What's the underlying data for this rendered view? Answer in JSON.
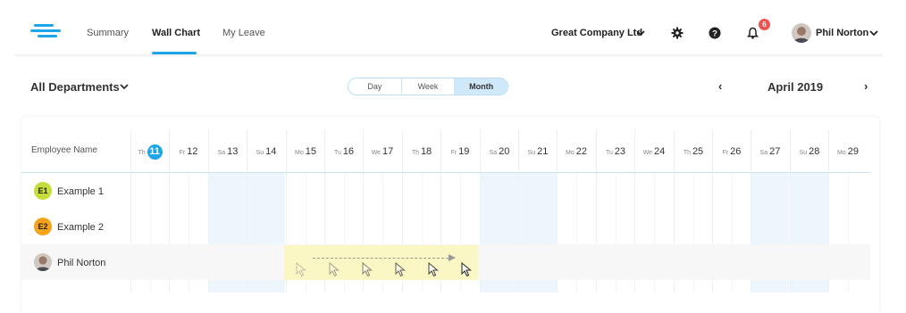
{
  "nav": {
    "tabs": [
      {
        "label": "Summary"
      },
      {
        "label": "Wall Chart"
      },
      {
        "label": "My Leave"
      }
    ],
    "active_tab": "Wall Chart",
    "company": "Great Company Ltd",
    "notifications_count": "6",
    "user_name": "Phil Norton",
    "icons": [
      "logo-icon",
      "gear-icon",
      "help-icon",
      "bell-icon",
      "chevron-down-icon"
    ]
  },
  "toolbar": {
    "department": "All Departments",
    "views": [
      "Day",
      "Week",
      "Month"
    ],
    "active_view": "Month",
    "month": "April 2019",
    "prev": "‹",
    "next": "›"
  },
  "grid": {
    "employee_header": "Employee Name",
    "days": [
      {
        "wd": "Th",
        "d": "11",
        "today": true
      },
      {
        "wd": "Fr",
        "d": "12"
      },
      {
        "wd": "Sa",
        "d": "13",
        "weekend": true
      },
      {
        "wd": "Su",
        "d": "14",
        "weekend": true
      },
      {
        "wd": "Mo",
        "d": "15"
      },
      {
        "wd": "Tu",
        "d": "16"
      },
      {
        "wd": "We",
        "d": "17"
      },
      {
        "wd": "Th",
        "d": "18"
      },
      {
        "wd": "Fr",
        "d": "19"
      },
      {
        "wd": "Sa",
        "d": "20",
        "weekend": true
      },
      {
        "wd": "Su",
        "d": "21",
        "weekend": true
      },
      {
        "wd": "Mo",
        "d": "22"
      },
      {
        "wd": "Tu",
        "d": "23"
      },
      {
        "wd": "We",
        "d": "24"
      },
      {
        "wd": "Th",
        "d": "25"
      },
      {
        "wd": "Fr",
        "d": "26"
      },
      {
        "wd": "Sa",
        "d": "27",
        "weekend": true
      },
      {
        "wd": "Su",
        "d": "28",
        "weekend": true
      },
      {
        "wd": "Mo",
        "d": "29"
      }
    ],
    "employees": [
      {
        "initials": "E1",
        "name": "Example 1",
        "color": "#c6dd3c"
      },
      {
        "initials": "E2",
        "name": "Example 2",
        "color": "#f5a31a"
      },
      {
        "initials": "",
        "name": "Phil Norton",
        "color": "#8a6a5a"
      }
    ]
  },
  "colors": {
    "accent": "#1ea5e9",
    "weekend": "#eef6fd",
    "selection": "#fbf7c4",
    "badge": "#ef5350"
  }
}
